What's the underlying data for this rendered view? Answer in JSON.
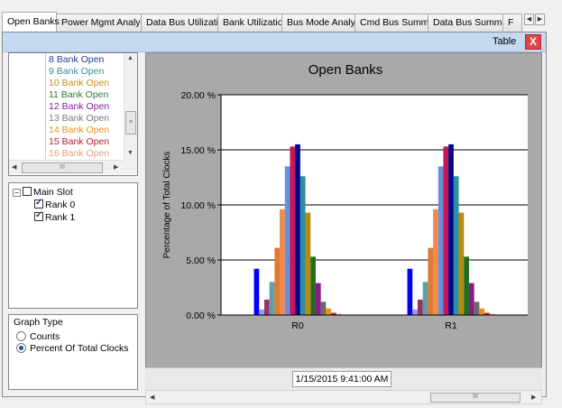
{
  "tabs": [
    {
      "label": "Open Banks",
      "active": true
    },
    {
      "label": "Power Mgmt Analysis",
      "active": false
    },
    {
      "label": "Data Bus Utilization",
      "active": false
    },
    {
      "label": "Bank Utilization",
      "active": false
    },
    {
      "label": "Bus Mode Analysis",
      "active": false
    },
    {
      "label": "Cmd Bus Summary",
      "active": false
    },
    {
      "label": "Data Bus Summary",
      "active": false
    },
    {
      "label": "F",
      "active": false
    }
  ],
  "toolbar": {
    "table_label": "Table",
    "close_label": "X"
  },
  "bank_list": {
    "items": [
      {
        "label": "8 Bank Open",
        "color": "#1f3b8f"
      },
      {
        "label": "9 Bank Open",
        "color": "#3a8a9a"
      },
      {
        "label": "10 Bank Open",
        "color": "#c8901a"
      },
      {
        "label": "11 Bank Open",
        "color": "#2e7d32"
      },
      {
        "label": "12 Bank Open",
        "color": "#8a1a9a"
      },
      {
        "label": "13 Bank Open",
        "color": "#7a7a7a"
      },
      {
        "label": "14 Bank Open",
        "color": "#f0901a"
      },
      {
        "label": "15 Bank Open",
        "color": "#c0182a"
      },
      {
        "label": "16 Bank Open",
        "color": "#e8a080"
      }
    ],
    "scroll_thumb": "≡",
    "hscroll_thumb": "III"
  },
  "tree": {
    "root": {
      "label": "Main Slot",
      "expander": "−"
    },
    "children": [
      {
        "label": "Rank 0",
        "checked": true
      },
      {
        "label": "Rank 1",
        "checked": true
      }
    ]
  },
  "graph_type": {
    "title": "Graph Type",
    "options": [
      {
        "label": "Counts",
        "selected": false
      },
      {
        "label": "Percent Of Total Clocks",
        "selected": true
      }
    ]
  },
  "timestamp": "1/15/2015 9:41:00 AM",
  "chart_hscroll_thumb": "III",
  "chart_data": {
    "type": "bar",
    "title": "Open Banks",
    "ylabel": "Percentage of Total Clocks",
    "xlabel": "",
    "ylim": [
      0,
      20
    ],
    "yticks": [
      "0.00 %",
      "5.00 %",
      "10.00 %",
      "15.00 %",
      "20.00 %"
    ],
    "grid": true,
    "categories": [
      "R0",
      "R1"
    ],
    "series": [
      {
        "color": "#0000ff",
        "values": [
          4.2,
          4.2
        ]
      },
      {
        "color": "#9999ff",
        "values": [
          0.5,
          0.5
        ]
      },
      {
        "color": "#993366",
        "values": [
          1.4,
          1.4
        ]
      },
      {
        "color": "#5fa0a8",
        "values": [
          3.0,
          3.0
        ]
      },
      {
        "color": "#e07a30",
        "values": [
          6.1,
          6.1
        ]
      },
      {
        "color": "#f08a50",
        "values": [
          9.6,
          9.6
        ]
      },
      {
        "color": "#6a8fd8",
        "values": [
          13.5,
          13.5
        ]
      },
      {
        "color": "#c8145a",
        "values": [
          15.3,
          15.3
        ]
      },
      {
        "color": "#00008b",
        "values": [
          15.5,
          15.5
        ]
      },
      {
        "color": "#2f8f9f",
        "values": [
          12.6,
          12.6
        ]
      },
      {
        "color": "#b88a10",
        "values": [
          9.3,
          9.3
        ]
      },
      {
        "color": "#1f6e1f",
        "values": [
          5.3,
          5.3
        ]
      },
      {
        "color": "#8b1a8b",
        "values": [
          2.9,
          2.9
        ]
      },
      {
        "color": "#6b6b6b",
        "values": [
          1.2,
          1.2
        ]
      },
      {
        "color": "#e8901a",
        "values": [
          0.6,
          0.6
        ]
      },
      {
        "color": "#b0202a",
        "values": [
          0.2,
          0.2
        ]
      },
      {
        "color": "#e0a088",
        "values": [
          0.1,
          0.1
        ]
      }
    ]
  }
}
